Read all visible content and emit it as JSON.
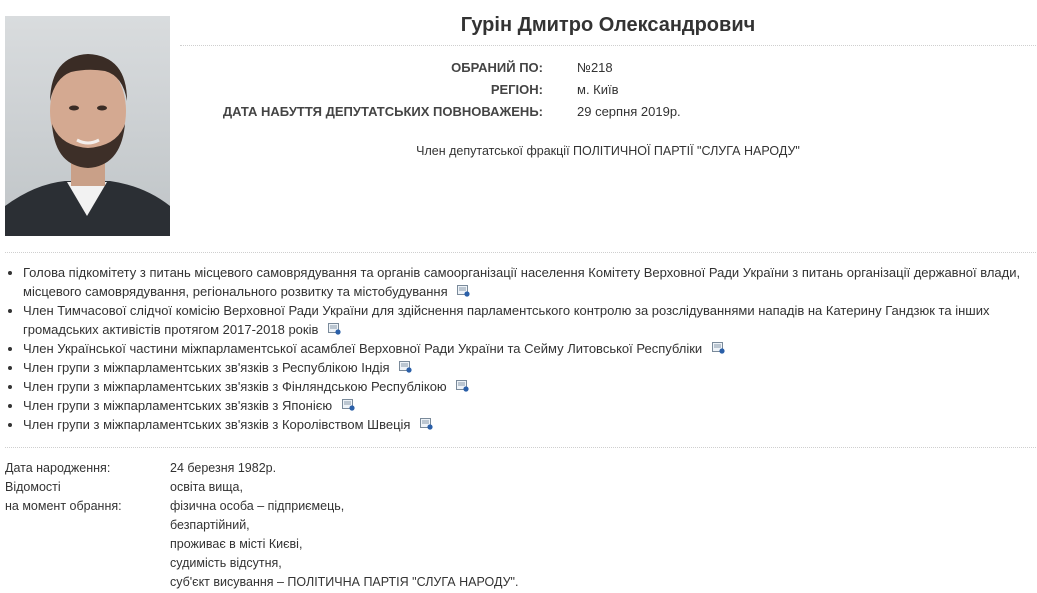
{
  "deputy": {
    "name": "Гурін Дмитро Олександрович",
    "info": [
      {
        "label": "ОБРАНИЙ ПО:",
        "value": "№218"
      },
      {
        "label": "РЕГІОН:",
        "value": "м. Київ"
      },
      {
        "label": "ДАТА НАБУТТЯ ДЕПУТАТСЬКИХ ПОВНОВАЖЕНЬ:",
        "value": "29 серпня 2019р."
      }
    ],
    "faction": "Член депутатської фракції ПОЛІТИЧНОЇ ПАРТІЇ \"СЛУГА НАРОДУ\""
  },
  "roles": [
    {
      "line1": "Голова підкомітету з питань місцевого самоврядування та органів самоорганізації населення Комітету Верховної Ради України з питань організації державної влади,",
      "line2": "місцевого самоврядування, регіонального розвитку та містобудування"
    },
    {
      "line1": "Член Тимчасової слідчої комісію Верховної Ради України для здійснення парламентського контролю за розслідуваннями нападів на Катерину Гандзюк та інших",
      "line2": "громадських активістів протягом 2017-2018 років"
    },
    {
      "line1": "Член Української частини міжпарламентської асамблеї Верховної Ради України та Сейму Литовської Республіки"
    },
    {
      "line1": "Член групи з міжпарламентських зв'язків з Республікою Індія"
    },
    {
      "line1": "Член групи з міжпарламентських зв'язків з Фінляндською Республікою"
    },
    {
      "line1": "Член групи з міжпарламентських зв'язків з Японією"
    },
    {
      "line1": "Член групи з міжпарламентських зв'язків з Королівством Швеція"
    }
  ],
  "bio": {
    "birth_label": "Дата народження:",
    "birth_value": "24 березня 1982р.",
    "info_label_1": "Відомості",
    "info_label_2": "на момент обрання:",
    "info_lines": [
      "освіта вища,",
      "фізична особа – підприємець,",
      "безпартійний,",
      "проживає в місті Києві,",
      "судимість відсутня,",
      "суб'єкт висування – ПОЛІТИЧНА ПАРТІЯ \"СЛУГА НАРОДУ\"."
    ]
  },
  "icons": {
    "role_link": "document-link-icon",
    "portrait": "portrait-photo"
  }
}
